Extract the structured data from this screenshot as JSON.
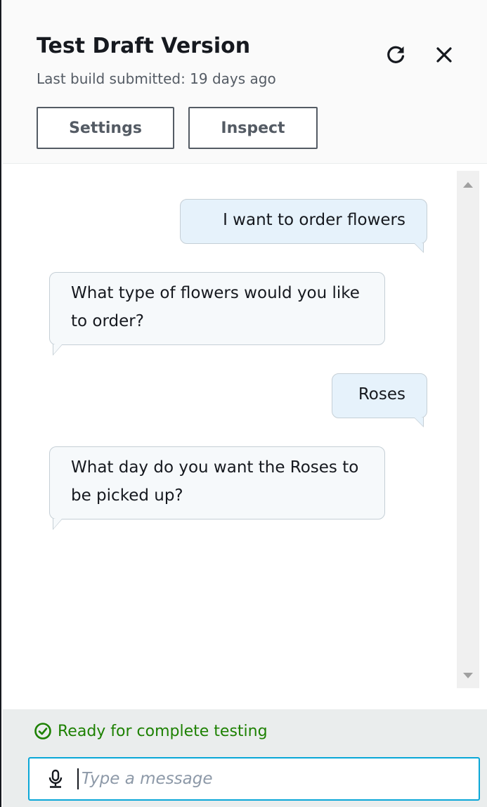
{
  "header": {
    "title": "Test Draft Version",
    "subtitle": "Last build submitted: 19 days ago",
    "settings_label": "Settings",
    "inspect_label": "Inspect",
    "icons": [
      "refresh-icon",
      "close-icon"
    ]
  },
  "chat": {
    "messages": [
      {
        "sender": "user",
        "text": "I want to order flowers"
      },
      {
        "sender": "bot",
        "text": "What type of flowers would you like to order?"
      },
      {
        "sender": "user",
        "text": "Roses"
      },
      {
        "sender": "bot",
        "text": "What day do you want the Roses to be picked up?"
      }
    ]
  },
  "footer": {
    "status_text": "Ready for complete testing",
    "status_icon": "check-circle-icon",
    "input_value": "",
    "input_placeholder": "Type a message",
    "mic_icon": "microphone-icon"
  },
  "colors": {
    "user_bubble": "#e6f2fb",
    "bot_bubble": "#f6f9fb",
    "status_green": "#1d8102",
    "input_focus_border": "#0aa7d7"
  }
}
